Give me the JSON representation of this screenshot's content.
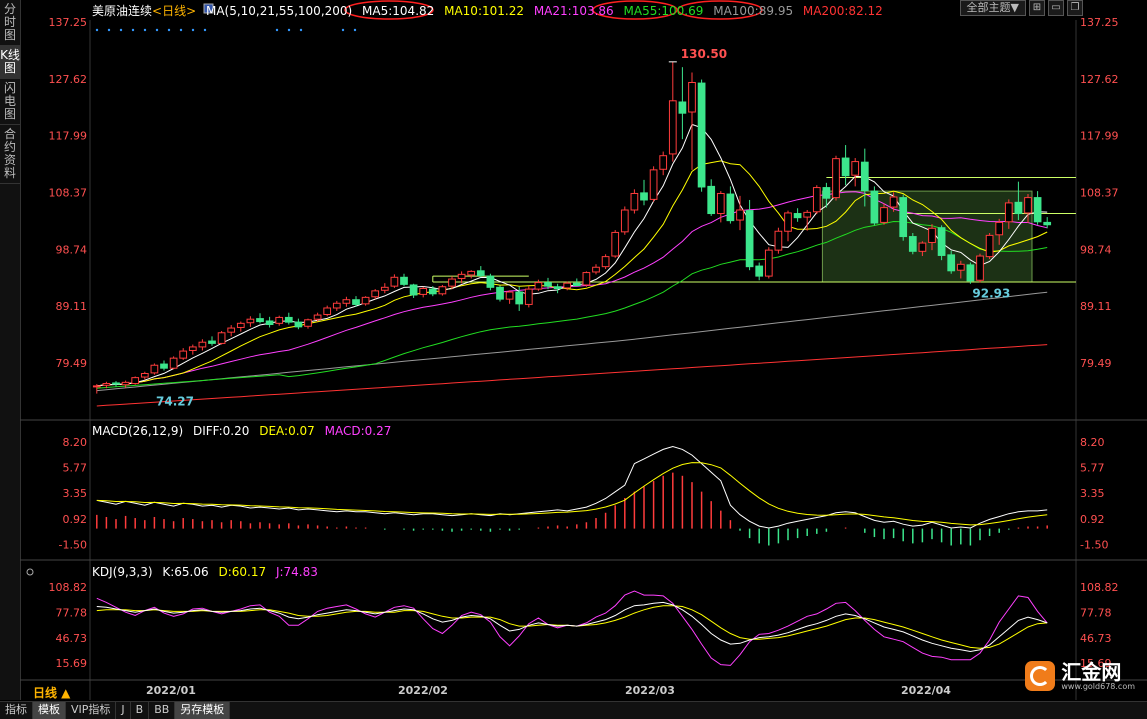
{
  "left_tabs": [
    "分时图",
    "K线图",
    "闪电图",
    "合约资料"
  ],
  "header": {
    "symbol": "美原油连续",
    "period_tag": "<日线>",
    "ma_params": "MA(5,10,21,55,100,200)",
    "ma_values": [
      {
        "label": "MA5:104.82",
        "color": "#ffffff"
      },
      {
        "label": "MA10:101.22",
        "color": "#ffff00"
      },
      {
        "label": "MA21:103.86",
        "color": "#ff40ff"
      },
      {
        "label": "MA55:100.69",
        "color": "#22dd22"
      },
      {
        "label": "MA100:89.95",
        "color": "#999999"
      },
      {
        "label": "MA200:82.12",
        "color": "#ff3333"
      }
    ],
    "theme_button": "全部主题▼"
  },
  "price_axis": [
    "137.25",
    "127.62",
    "117.99",
    "108.37",
    "98.74",
    "89.11",
    "79.49"
  ],
  "annotations": {
    "high": "130.50",
    "low_left": "74.27",
    "low_right": "92.93"
  },
  "macd": {
    "title": "MACD(26,12,9)",
    "diff": "DIFF:0.20",
    "dea": "DEA:0.07",
    "macd": "MACD:0.27",
    "axis": [
      "8.20",
      "5.77",
      "3.35",
      "0.92",
      "-1.50"
    ]
  },
  "kdj": {
    "title": "KDJ(9,3,3)",
    "k": "K:65.06",
    "d": "D:60.17",
    "j": "J:74.83",
    "axis": [
      "108.82",
      "77.78",
      "46.73",
      "15.69"
    ]
  },
  "period_label": "日线 ▲",
  "date_axis": [
    "2022/01",
    "2022/02",
    "2022/03",
    "2022/04"
  ],
  "bottom_tabs": [
    "指标",
    "模板",
    "VIP指标",
    "J",
    "B",
    "BB",
    "另存模板"
  ],
  "logo": {
    "name": "汇金网",
    "url": "www.gold678.com"
  },
  "colors": {
    "up": "#ff3c3c",
    "down": "#3ce68c",
    "bg": "#000000"
  },
  "chart_data": [
    {
      "type": "candlestick",
      "title": "美原油连续",
      "ylim": [
        70.5,
        137.25
      ],
      "candles": [
        [
          75.5,
          75.9,
          74.3,
          75.6
        ],
        [
          75.7,
          76.3,
          75.2,
          76.0
        ],
        [
          76.1,
          76.4,
          75.5,
          75.9
        ],
        [
          75.8,
          76.5,
          75.3,
          76.2
        ],
        [
          76.0,
          77.2,
          75.8,
          77.0
        ],
        [
          77.1,
          78.0,
          76.7,
          77.7
        ],
        [
          77.8,
          79.4,
          77.5,
          79.1
        ],
        [
          79.3,
          79.9,
          78.2,
          78.6
        ],
        [
          78.6,
          80.6,
          78.4,
          80.3
        ],
        [
          80.3,
          82.0,
          80.0,
          81.5
        ],
        [
          81.6,
          82.6,
          80.9,
          82.2
        ],
        [
          82.2,
          83.5,
          81.6,
          83.0
        ],
        [
          83.2,
          84.0,
          82.4,
          82.8
        ],
        [
          82.8,
          84.9,
          82.6,
          84.6
        ],
        [
          84.7,
          85.9,
          84.0,
          85.4
        ],
        [
          85.5,
          86.5,
          84.8,
          86.2
        ],
        [
          86.3,
          87.4,
          85.6,
          86.9
        ],
        [
          87.0,
          87.9,
          86.2,
          86.5
        ],
        [
          86.6,
          87.3,
          85.5,
          86.0
        ],
        [
          86.2,
          87.5,
          85.8,
          87.2
        ],
        [
          87.2,
          88.0,
          86.0,
          86.4
        ],
        [
          86.4,
          87.0,
          85.2,
          85.6
        ],
        [
          85.7,
          87.0,
          85.3,
          86.8
        ],
        [
          86.9,
          88.0,
          86.5,
          87.6
        ],
        [
          87.7,
          89.2,
          87.4,
          88.8
        ],
        [
          88.8,
          90.0,
          88.3,
          89.6
        ],
        [
          89.6,
          90.7,
          89.0,
          90.2
        ],
        [
          90.2,
          90.8,
          89.0,
          89.4
        ],
        [
          89.5,
          90.8,
          89.2,
          90.6
        ],
        [
          90.7,
          92.0,
          90.3,
          91.7
        ],
        [
          91.8,
          93.0,
          91.3,
          92.3
        ],
        [
          92.5,
          94.5,
          92.2,
          94.0
        ],
        [
          94.0,
          94.6,
          92.5,
          92.8
        ],
        [
          92.7,
          92.9,
          90.5,
          91.0
        ],
        [
          91.1,
          92.4,
          90.6,
          92.1
        ],
        [
          92.0,
          92.5,
          90.8,
          91.2
        ],
        [
          91.2,
          92.7,
          90.9,
          92.4
        ],
        [
          92.5,
          94.2,
          92.0,
          93.7
        ],
        [
          93.8,
          95.0,
          93.0,
          94.5
        ],
        [
          94.4,
          95.2,
          93.8,
          95.0
        ],
        [
          95.1,
          95.9,
          94.0,
          94.3
        ],
        [
          94.2,
          94.6,
          91.8,
          92.3
        ],
        [
          92.3,
          92.6,
          89.9,
          90.3
        ],
        [
          90.3,
          91.8,
          89.5,
          91.5
        ],
        [
          91.5,
          92.4,
          88.3,
          89.5
        ],
        [
          89.4,
          92.5,
          88.9,
          92.0
        ],
        [
          92.0,
          93.6,
          91.7,
          93.1
        ],
        [
          93.1,
          93.9,
          92.0,
          92.5
        ],
        [
          92.4,
          92.9,
          91.3,
          92.1
        ],
        [
          92.2,
          93.3,
          91.8,
          93.0
        ],
        [
          93.0,
          93.8,
          92.5,
          92.6
        ],
        [
          92.7,
          95.0,
          92.4,
          94.8
        ],
        [
          94.9,
          96.2,
          94.5,
          95.7
        ],
        [
          95.8,
          97.9,
          95.4,
          97.5
        ],
        [
          97.6,
          102.0,
          97.3,
          101.6
        ],
        [
          101.7,
          106.0,
          101.2,
          105.4
        ],
        [
          105.4,
          108.9,
          104.8,
          108.2
        ],
        [
          108.3,
          110.5,
          106.2,
          107.1
        ],
        [
          107.2,
          112.8,
          106.8,
          112.2
        ],
        [
          112.3,
          115.3,
          111.3,
          114.6
        ],
        [
          114.9,
          130.5,
          113.6,
          123.9
        ],
        [
          123.7,
          129.6,
          117.4,
          121.8
        ],
        [
          122.0,
          128.7,
          112.2,
          127.0
        ],
        [
          126.9,
          127.5,
          108.5,
          109.3
        ],
        [
          109.4,
          110.6,
          104.4,
          104.8
        ],
        [
          104.8,
          108.6,
          103.3,
          108.2
        ],
        [
          108.1,
          109.4,
          103.1,
          103.6
        ],
        [
          103.7,
          107.8,
          102.0,
          105.4
        ],
        [
          105.3,
          107.1,
          95.2,
          95.8
        ],
        [
          95.9,
          96.5,
          93.5,
          94.2
        ],
        [
          94.2,
          99.1,
          93.8,
          98.6
        ],
        [
          98.6,
          102.4,
          98.0,
          101.8
        ],
        [
          101.8,
          105.3,
          100.1,
          104.9
        ],
        [
          104.8,
          105.7,
          103.4,
          104.1
        ],
        [
          104.2,
          105.4,
          101.9,
          105.0
        ],
        [
          105.1,
          109.6,
          104.7,
          109.2
        ],
        [
          109.2,
          110.0,
          105.8,
          107.4
        ],
        [
          107.5,
          114.6,
          107.0,
          114.1
        ],
        [
          114.2,
          116.4,
          109.6,
          111.2
        ],
        [
          111.3,
          114.2,
          109.4,
          113.6
        ],
        [
          113.5,
          115.8,
          106.0,
          108.7
        ],
        [
          108.6,
          109.4,
          102.8,
          103.2
        ],
        [
          103.3,
          106.5,
          102.9,
          105.8
        ],
        [
          105.9,
          108.4,
          105.1,
          107.6
        ],
        [
          107.5,
          108.0,
          100.2,
          100.9
        ],
        [
          100.9,
          101.5,
          97.9,
          98.4
        ],
        [
          98.4,
          100.1,
          97.6,
          99.8
        ],
        [
          99.9,
          103.0,
          98.6,
          102.3
        ],
        [
          102.4,
          102.8,
          96.9,
          97.7
        ],
        [
          97.8,
          98.5,
          94.6,
          95.1
        ],
        [
          95.2,
          96.8,
          93.8,
          96.2
        ],
        [
          96.1,
          96.5,
          92.9,
          93.4
        ],
        [
          93.5,
          98.0,
          93.1,
          97.6
        ],
        [
          97.5,
          101.5,
          97.1,
          101.1
        ],
        [
          101.2,
          103.9,
          99.5,
          103.3
        ],
        [
          103.4,
          107.2,
          102.2,
          106.6
        ],
        [
          106.7,
          110.2,
          103.7,
          104.8
        ],
        [
          104.9,
          108.1,
          103.2,
          107.5
        ],
        [
          107.5,
          108.6,
          102.9,
          103.4
        ],
        [
          103.3,
          104.2,
          102.3,
          102.9
        ]
      ]
    },
    {
      "type": "bar",
      "title": "MACD(26,12,9)",
      "ylim": [
        -2.5,
        8.2
      ],
      "values": [
        1.3,
        1.1,
        0.9,
        1.2,
        1.0,
        0.8,
        1.1,
        0.9,
        0.7,
        1.0,
        0.9,
        0.7,
        0.8,
        0.6,
        0.8,
        0.7,
        0.5,
        0.6,
        0.5,
        0.4,
        0.5,
        0.3,
        0.4,
        0.3,
        0.2,
        0.1,
        0.2,
        0.1,
        0.1,
        0.0,
        -0.1,
        0.0,
        -0.1,
        -0.2,
        -0.1,
        -0.1,
        -0.2,
        -0.3,
        -0.2,
        -0.1,
        -0.2,
        -0.3,
        -0.1,
        -0.2,
        -0.1,
        0.0,
        0.1,
        0.2,
        0.3,
        0.2,
        0.4,
        0.6,
        1.0,
        1.5,
        2.2,
        2.9,
        3.5,
        4.0,
        4.5,
        5.0,
        5.3,
        5.0,
        4.4,
        3.5,
        2.6,
        1.7,
        0.8,
        -0.2,
        -0.9,
        -1.4,
        -1.6,
        -1.4,
        -1.1,
        -0.9,
        -0.7,
        -0.5,
        -0.3,
        0.0,
        0.1,
        0.0,
        -0.4,
        -0.8,
        -1.0,
        -0.9,
        -1.2,
        -1.4,
        -1.3,
        -1.0,
        -1.3,
        -1.6,
        -1.5,
        -1.6,
        -1.1,
        -0.7,
        -0.4,
        -0.1,
        0.1,
        0.2,
        0.2,
        0.3
      ]
    },
    {
      "type": "line",
      "title": "KDJ(9,3,3)",
      "ylim": [
        0,
        115
      ],
      "series": [
        {
          "name": "K",
          "color": "#ffffff",
          "values": [
            85,
            84,
            82,
            80,
            78,
            80,
            82,
            79,
            77,
            78,
            80,
            81,
            79,
            78,
            79,
            80,
            82,
            83,
            80,
            77,
            72,
            70,
            72,
            75,
            77,
            79,
            81,
            80,
            78,
            76,
            78,
            80,
            82,
            81,
            76,
            70,
            66,
            68,
            72,
            74,
            73,
            70,
            62,
            55,
            57,
            62,
            65,
            63,
            61,
            62,
            61,
            63,
            66,
            69,
            74,
            81,
            86,
            87,
            89,
            90,
            87,
            81,
            73,
            63,
            52,
            44,
            39,
            40,
            44,
            47,
            48,
            50,
            53,
            57,
            61,
            64,
            68,
            73,
            76,
            74,
            70,
            65,
            60,
            57,
            54,
            49,
            44,
            40,
            37,
            34,
            32,
            30,
            32,
            38,
            48,
            58,
            68,
            72,
            69,
            65
          ]
        },
        {
          "name": "D",
          "color": "#ffff00",
          "values": [
            80,
            81,
            81,
            81,
            80,
            80,
            81,
            80,
            79,
            79,
            79,
            80,
            79,
            79,
            79,
            79,
            80,
            81,
            81,
            79,
            77,
            74,
            73,
            73,
            74,
            76,
            78,
            79,
            79,
            78,
            78,
            78,
            80,
            80,
            79,
            76,
            73,
            71,
            71,
            72,
            72,
            72,
            69,
            64,
            61,
            61,
            62,
            63,
            62,
            62,
            61,
            62,
            63,
            65,
            68,
            72,
            77,
            81,
            84,
            86,
            86,
            85,
            81,
            75,
            67,
            59,
            52,
            47,
            45,
            45,
            46,
            47,
            49,
            52,
            55,
            58,
            61,
            65,
            69,
            71,
            71,
            69,
            66,
            63,
            60,
            56,
            52,
            48,
            44,
            41,
            38,
            35,
            34,
            35,
            39,
            46,
            53,
            60,
            64,
            65
          ]
        },
        {
          "name": "J",
          "color": "#ff40ff",
          "values": [
            95,
            90,
            84,
            78,
            74,
            80,
            84,
            77,
            73,
            76,
            82,
            83,
            79,
            76,
            79,
            82,
            86,
            87,
            78,
            73,
            62,
            62,
            70,
            79,
            83,
            85,
            87,
            82,
            76,
            72,
            78,
            84,
            86,
            83,
            70,
            58,
            52,
            62,
            74,
            78,
            75,
            66,
            48,
            37,
            49,
            64,
            71,
            63,
            59,
            62,
            61,
            65,
            72,
            77,
            86,
            99,
            104,
            99,
            99,
            98,
            89,
            73,
            57,
            39,
            22,
            14,
            13,
            26,
            42,
            51,
            52,
            56,
            61,
            67,
            73,
            76,
            82,
            89,
            90,
            80,
            68,
            57,
            48,
            45,
            42,
            35,
            28,
            24,
            23,
            20,
            20,
            20,
            28,
            44,
            66,
            82,
            98,
            96,
            79,
            65
          ]
        }
      ]
    }
  ]
}
